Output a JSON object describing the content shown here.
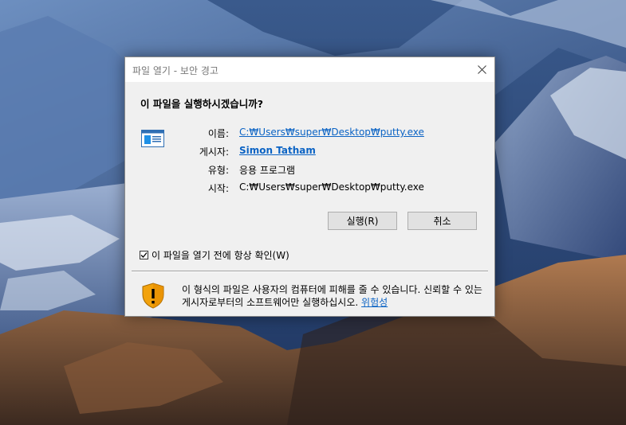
{
  "dialog": {
    "title": "파일 열기 - 보안 경고",
    "question": "이 파일을 실행하시겠습니까?",
    "fields": {
      "name_label": "이름:",
      "name_value": "C:₩Users₩super₩Desktop₩putty.exe",
      "publisher_label": "게시자:",
      "publisher_value": "Simon Tatham",
      "type_label": "유형:",
      "type_value": "응용 프로그램",
      "from_label": "시작:",
      "from_value": "C:₩Users₩super₩Desktop₩putty.exe"
    },
    "buttons": {
      "run": "실행(R)",
      "cancel": "취소"
    },
    "checkbox": {
      "label": "이 파일을 열기 전에 항상 확인(W)",
      "checked": true
    },
    "warning": {
      "text": "이 형식의 파일은 사용자의 컴퓨터에 피해를 줄 수 있습니다. 신뢰할 수 있는 게시자로부터의 소프트웨어만 실행하십시오.",
      "link": "위험성"
    }
  },
  "icons": {
    "close": "close-icon",
    "file": "application-file-icon",
    "shield": "shield-warning-icon",
    "checkmark": "checkmark-icon"
  },
  "colors": {
    "link": "#0b63c4",
    "dialog_bg": "#f0f0f0",
    "shield_orange": "#f2a20c"
  }
}
